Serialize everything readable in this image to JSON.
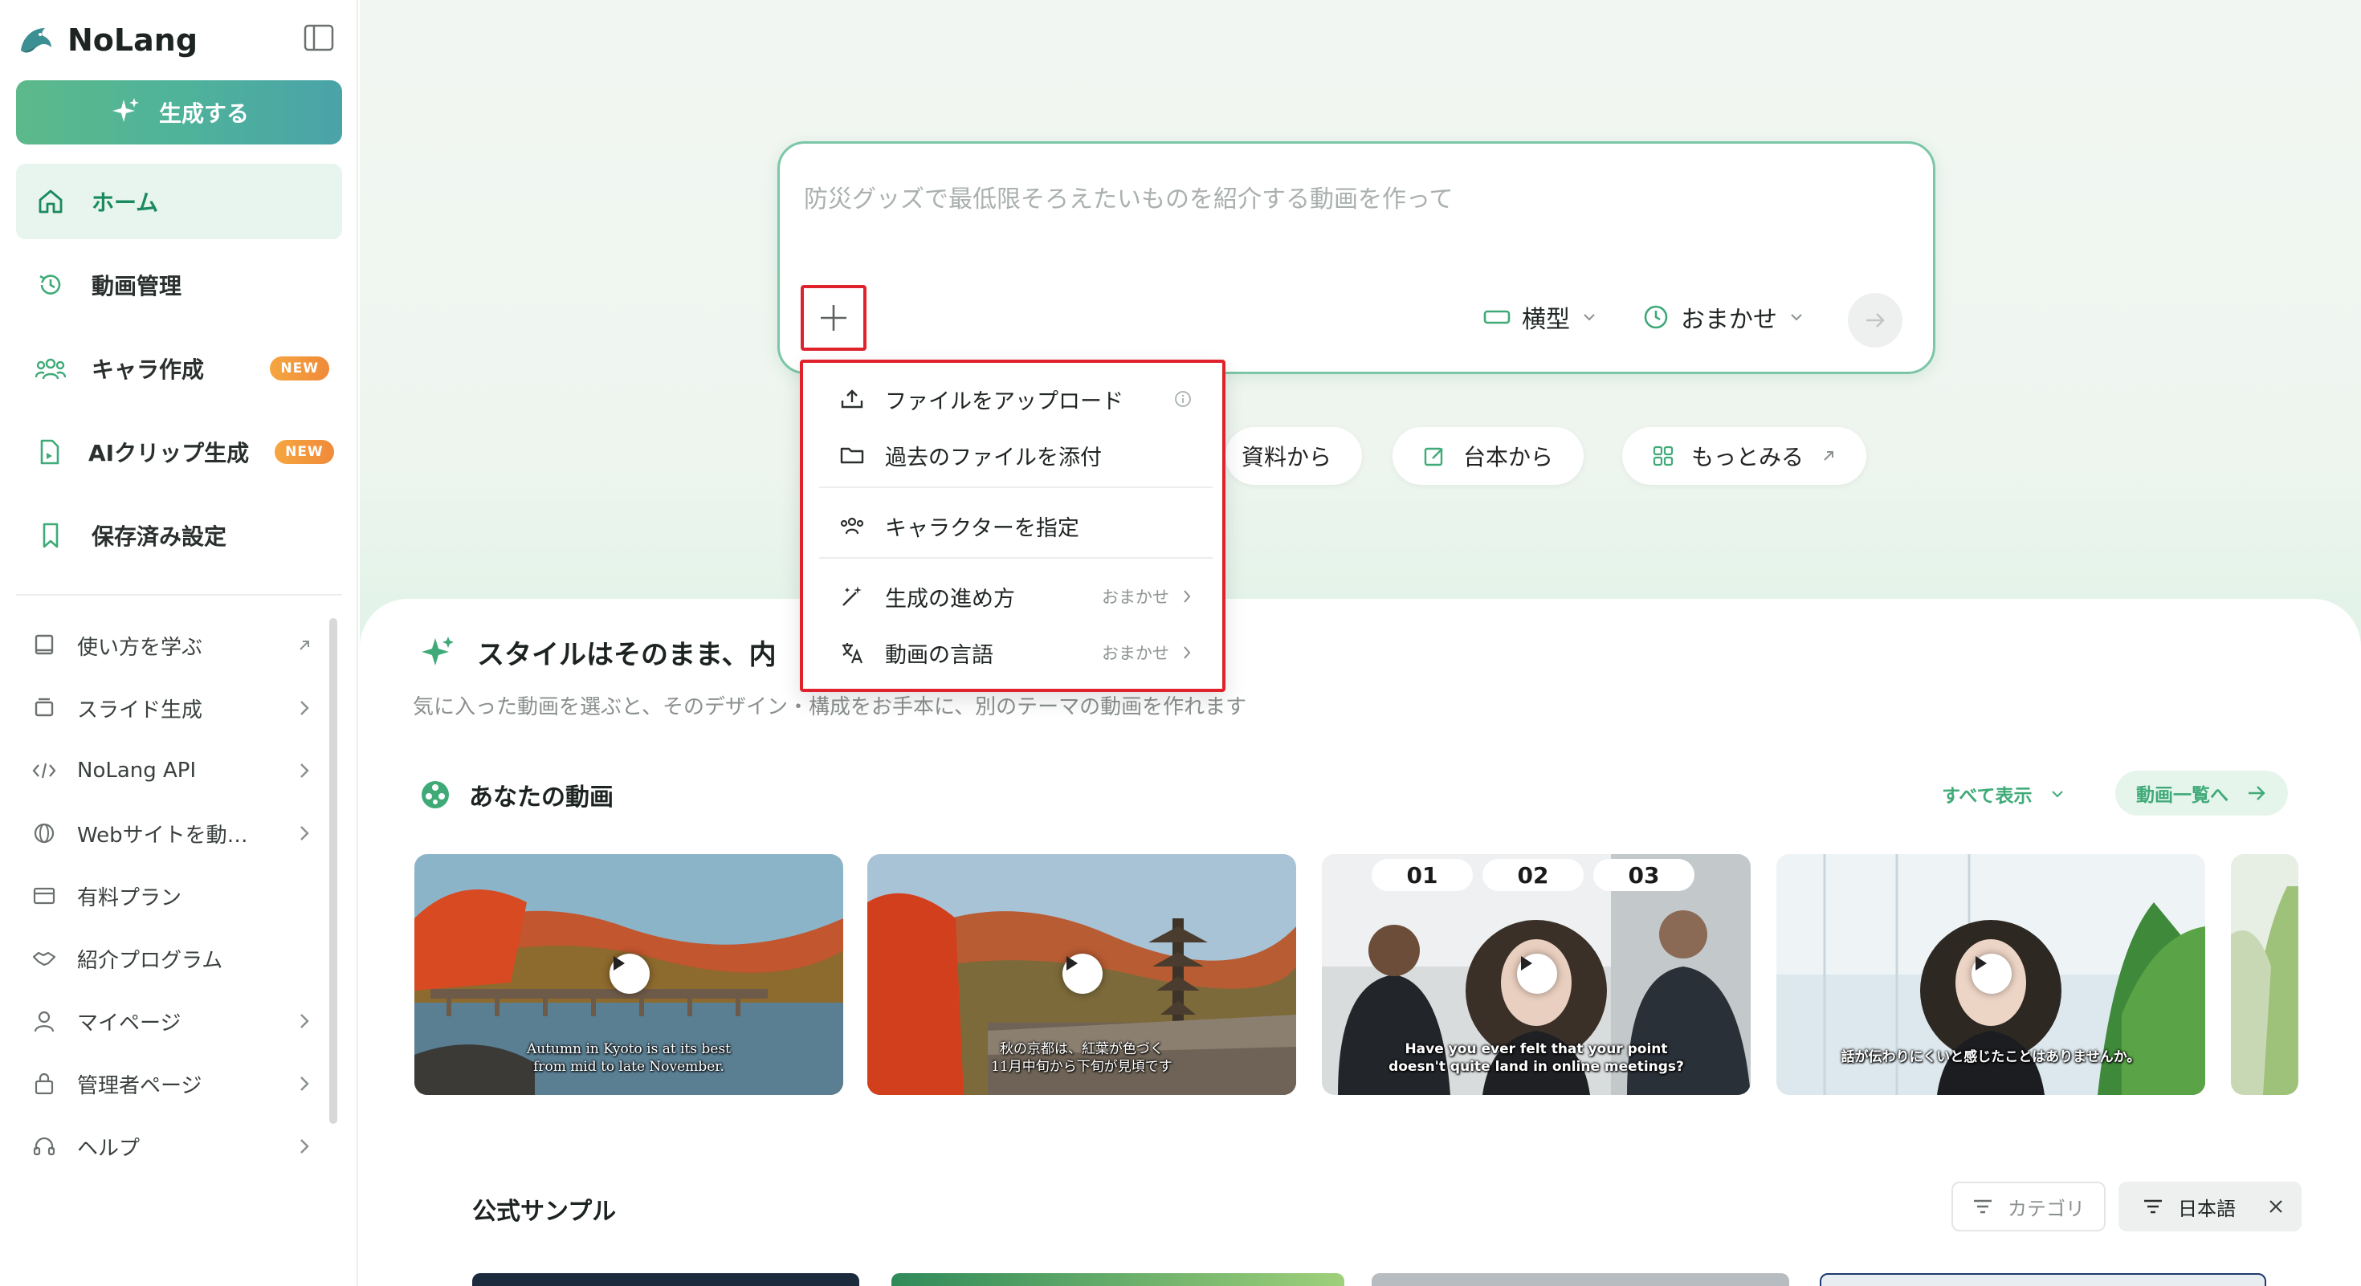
{
  "sidebar": {
    "brand": "NoLang",
    "generate_label": "生成する",
    "nav": [
      {
        "label": "ホーム",
        "icon": "home-icon",
        "active": true
      },
      {
        "label": "動画管理",
        "icon": "history-icon"
      },
      {
        "label": "キャラ作成",
        "icon": "characters-icon",
        "badge": "NEW"
      },
      {
        "label": "AIクリップ生成",
        "icon": "clip-icon",
        "badge": "NEW"
      },
      {
        "label": "保存済み設定",
        "icon": "bookmark-icon"
      }
    ],
    "sub": [
      {
        "label": "使い方を学ぶ",
        "icon": "book-icon",
        "trail": "external"
      },
      {
        "label": "スライド生成",
        "icon": "slides-icon",
        "trail": "chevron"
      },
      {
        "label": "NoLang API",
        "icon": "code-icon",
        "trail": "chevron"
      },
      {
        "label": "Webサイトを動…",
        "icon": "web-icon",
        "trail": "chevron"
      },
      {
        "label": "有料プラン",
        "icon": "card-icon",
        "trail": "none"
      },
      {
        "label": "紹介プログラム",
        "icon": "handshake-icon",
        "trail": "none"
      },
      {
        "label": "マイページ",
        "icon": "user-icon",
        "trail": "chevron"
      },
      {
        "label": "管理者ページ",
        "icon": "admin-icon",
        "trail": "chevron"
      },
      {
        "label": "ヘルプ",
        "icon": "headset-icon",
        "trail": "chevron"
      }
    ]
  },
  "prompt": {
    "placeholder": "防災グッズで最低限そろえたいものを紹介する動画を作って",
    "orientation": "横型",
    "duration": "おまかせ"
  },
  "quick_actions": [
    {
      "label": "資料から",
      "icon": "document-icon"
    },
    {
      "label": "台本から",
      "icon": "edit-icon"
    },
    {
      "label": "もっとみる",
      "icon": "grid-icon"
    }
  ],
  "menu": {
    "upload": "ファイルをアップロード",
    "attach_past": "過去のファイルを添付",
    "character": "キャラクターを指定",
    "progress": "生成の進め方",
    "progress_value": "おまかせ",
    "language": "動画の言語",
    "language_value": "おまかせ"
  },
  "content": {
    "style_title": "スタイルはそのまま、内",
    "style_sub": "気に入った動画を選ぶと、そのデザイン・構成をお手本に、別のテーマの動画を作れます",
    "your_videos": "あなたの動画",
    "show_all": "すべて表示",
    "video_list": "動画一覧へ",
    "videos": [
      {
        "caption": "Autumn in Kyoto is at its best\nfrom mid to late November."
      },
      {
        "caption": "秋の京都は、紅葉が色づく\n11月中旬から下旬が見頃です"
      },
      {
        "caption": "Have you ever felt that your point\ndoesn't quite land in online meetings?",
        "tags": [
          "01",
          "02",
          "03"
        ]
      },
      {
        "caption": "話が伝わりにくいと感じたことはありませんか。"
      }
    ],
    "official_samples": "公式サンプル",
    "category_filter": "カテゴリ",
    "language_filter": "日本語"
  },
  "colors": {
    "accent": "#3faa78",
    "highlight_box": "#e0222c",
    "badge": "#f29a3c"
  }
}
